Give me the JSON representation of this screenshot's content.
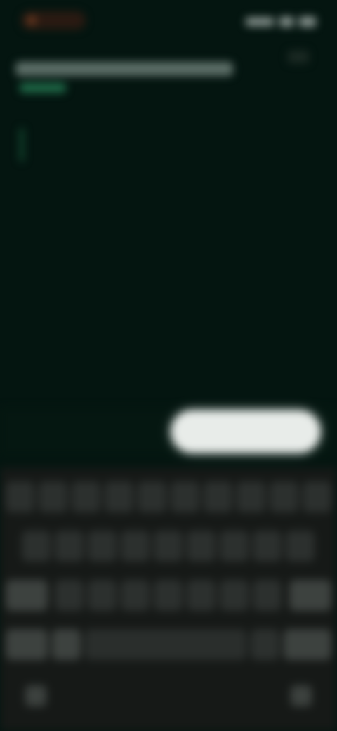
{
  "status": {
    "time": "",
    "icons": [
      "signal-icon",
      "wifi-icon",
      "battery-icon"
    ]
  },
  "prompt": {
    "text": ""
  },
  "actions": {
    "secondary_label": "",
    "primary_label": ""
  },
  "keyboard": {
    "row1": [
      "q",
      "w",
      "e",
      "r",
      "t",
      "y",
      "u",
      "i",
      "o",
      "p"
    ],
    "row2": [
      "a",
      "s",
      "d",
      "f",
      "g",
      "h",
      "j",
      "k",
      "l"
    ],
    "row3": [
      "shift",
      "z",
      "x",
      "c",
      "v",
      "b",
      "n",
      "m",
      "backspace"
    ],
    "row4": [
      "123",
      ",",
      "space",
      ".",
      "enter"
    ]
  },
  "colors": {
    "background": "#041510",
    "accent": "#1f6a48",
    "primary_button": "#e8ece9",
    "keyboard_bg": "#161917"
  }
}
